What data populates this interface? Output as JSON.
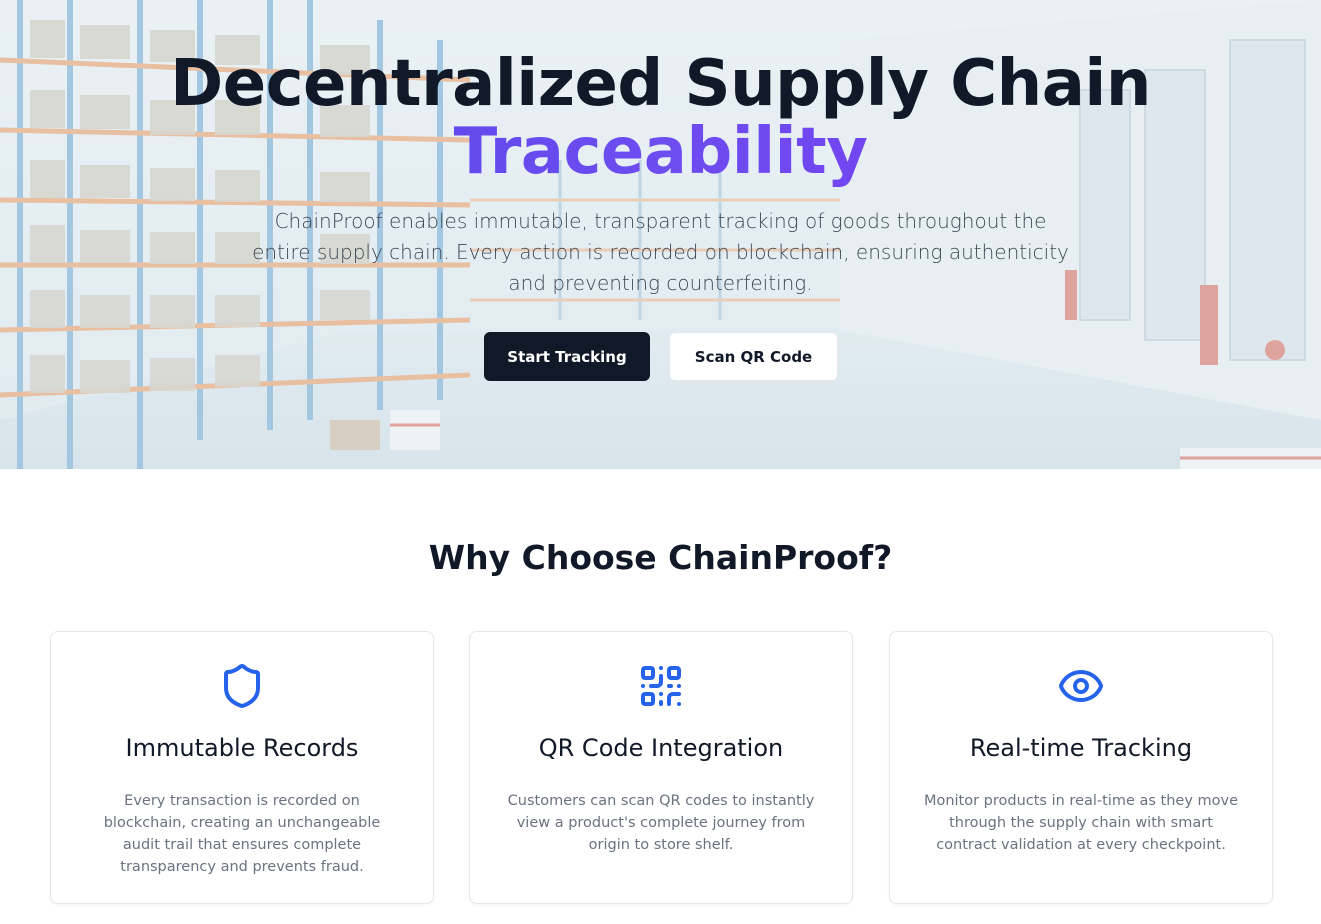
{
  "hero": {
    "title_line1": "Decentralized Supply Chain",
    "title_line2": "Traceability",
    "description": "ChainProof enables immutable, transparent tracking of goods throughout the entire supply chain. Every action is recorded on blockchain, ensuring authenticity and preventing counterfeiting.",
    "primary_button": "Start Tracking",
    "secondary_button": "Scan QR Code"
  },
  "features": {
    "title": "Why Choose ChainProof?",
    "items": [
      {
        "icon": "shield-icon",
        "title": "Immutable Records",
        "description": "Every transaction is recorded on blockchain, creating an unchangeable audit trail that ensures complete transparency and prevents fraud."
      },
      {
        "icon": "qr-code-icon",
        "title": "QR Code Integration",
        "description": "Customers can scan QR codes to instantly view a product's complete journey from origin to store shelf."
      },
      {
        "icon": "eye-icon",
        "title": "Real-time Tracking",
        "description": "Monitor products in real-time as they move through the supply chain with smart contract validation at every checkpoint."
      }
    ]
  },
  "colors": {
    "accent": "#2563eb",
    "gradient_start": "#4f46e5",
    "gradient_end": "#7c3aed",
    "dark_button": "#111827"
  }
}
